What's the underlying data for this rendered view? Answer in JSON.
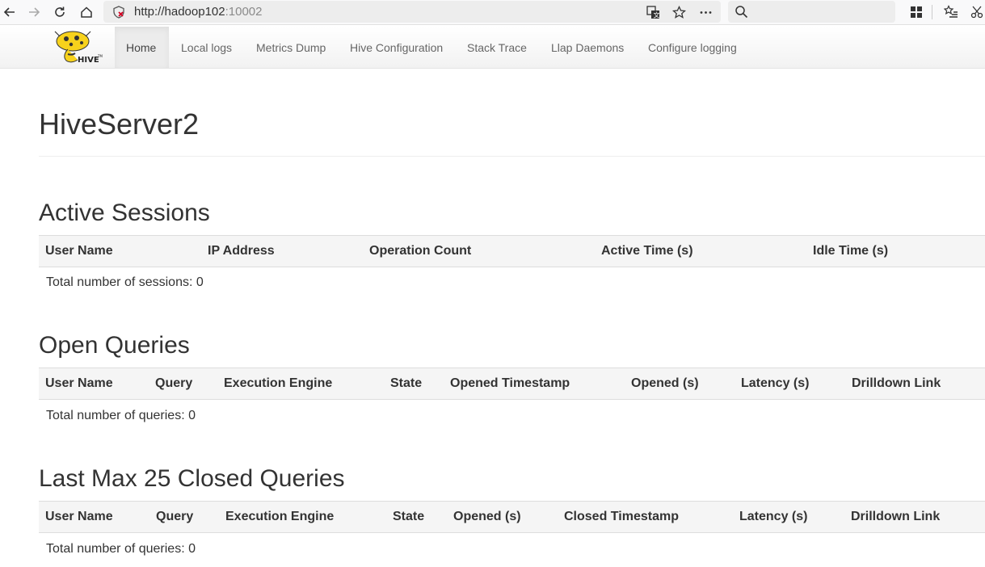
{
  "browser": {
    "url_host": "http://hadoop102",
    "url_port": ":10002"
  },
  "navbar": {
    "items": [
      {
        "label": "Home"
      },
      {
        "label": "Local logs"
      },
      {
        "label": "Metrics Dump"
      },
      {
        "label": "Hive Configuration"
      },
      {
        "label": "Stack Trace"
      },
      {
        "label": "Llap Daemons"
      },
      {
        "label": "Configure logging"
      }
    ],
    "active": "Home"
  },
  "page_title": "HiveServer2",
  "active_sessions": {
    "title": "Active Sessions",
    "columns": [
      "User Name",
      "IP Address",
      "Operation Count",
      "Active Time (s)",
      "Idle Time (s)"
    ],
    "total": "Total number of sessions: 0"
  },
  "open_queries": {
    "title": "Open Queries",
    "columns": [
      "User Name",
      "Query",
      "Execution Engine",
      "State",
      "Opened Timestamp",
      "Opened (s)",
      "Latency (s)",
      "Drilldown Link"
    ],
    "total": "Total number of queries: 0"
  },
  "closed_queries": {
    "title": "Last Max 25 Closed Queries",
    "columns": [
      "User Name",
      "Query",
      "Execution Engine",
      "State",
      "Opened (s)",
      "Closed Timestamp",
      "Latency (s)",
      "Drilldown Link"
    ],
    "total": "Total number of queries: 0"
  }
}
